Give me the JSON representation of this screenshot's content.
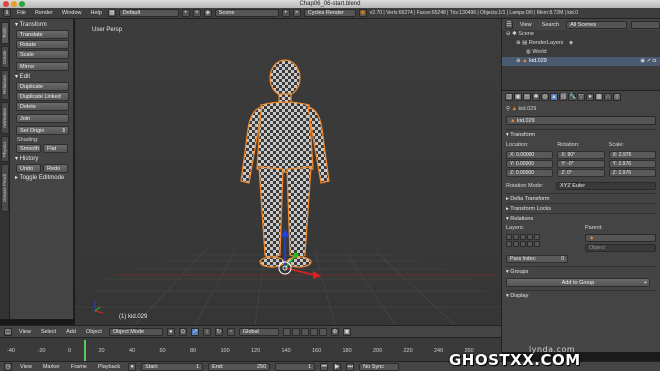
{
  "window_title": "Chap06_06-start.blend",
  "info": {
    "menus": [
      "File",
      "Render",
      "Window",
      "Help"
    ],
    "layout": "Default",
    "scene": "Scene",
    "engine": "Cycles Render",
    "stats": "v2.70 | Verts:66274 | Faces:65248 | Tris:130496 | Objects:1/1 | Lamps:0/0 | Mem:8.72M | kid.0"
  },
  "vertical_tabs": [
    "Tools",
    "Create",
    "Relations",
    "Animation",
    "Physics",
    "Grease Pencil"
  ],
  "tools": {
    "transform_header": "Transform",
    "transform_buttons": [
      "Translate",
      "Rotate",
      "Scale"
    ],
    "mirror": "Mirror",
    "edit_header": "Edit",
    "edit_buttons": [
      "Duplicate",
      "Duplicate Linked",
      "Delete"
    ],
    "join": "Join",
    "set_origin": "Set Origin",
    "shading_label": "Shading:",
    "smooth": "Smooth",
    "flat": "Flat",
    "history_header": "History",
    "undo": "Undo",
    "redo": "Redo",
    "toggle_editmode": "Toggle Editmode"
  },
  "viewport": {
    "label": "User Persp",
    "object_label": "(1) kid.029"
  },
  "viewport_header": {
    "menus": [
      "View",
      "Select",
      "Add",
      "Object"
    ],
    "mode": "Object Mode",
    "pivot": "Global"
  },
  "timeline": {
    "ticks": [
      "-40",
      "-20",
      "0",
      "20",
      "40",
      "60",
      "80",
      "100",
      "120",
      "140",
      "160",
      "180",
      "200",
      "220",
      "240",
      "260"
    ],
    "menus": [
      "View",
      "Marker",
      "Frame",
      "Playback"
    ],
    "start_label": "Start:",
    "start_value": "1",
    "end_label": "End:",
    "end_value": "250",
    "current": "1",
    "sync": "No Sync"
  },
  "outliner": {
    "header_menus": [
      "View",
      "Search"
    ],
    "filter": "All Scenes",
    "rows": [
      "Scene",
      "RenderLayers",
      "World",
      "kid.029"
    ]
  },
  "properties": {
    "breadcrumb": "kid.029",
    "object_name": "kid.029",
    "transform_header": "Transform",
    "location_label": "Location:",
    "rotation_label": "Rotation:",
    "scale_label": "Scale:",
    "location": [
      "X: 0.00000",
      "Y: 0.00000",
      "Z: 0.00000"
    ],
    "rotation": [
      "X: 90°",
      "Y: -0°",
      "Z: 0°"
    ],
    "scale": [
      "X: 2.976",
      "Y: 2.976",
      "Z: 2.976"
    ],
    "rotation_mode_label": "Rotation Mode:",
    "rotation_mode": "XYZ Euler",
    "delta_transform": "Delta Transform",
    "transform_locks": "Transform Locks",
    "relations": "Relations",
    "layers_label": "Layers:",
    "parent_label": "Parent:",
    "parent_type": "Object",
    "pass_index_label": "Pass Index:",
    "pass_index": "0",
    "groups": "Groups",
    "add_to_group": "Add to Group",
    "display": "Display"
  },
  "watermark": {
    "main": "GHOSTXX.COM",
    "sub": "lynda.com"
  },
  "colors": {
    "accent": "#5680c2",
    "selection_outline": "#f28a2a",
    "axis_x": "#e02020",
    "axis_y": "#20c020",
    "axis_z": "#2040e0"
  }
}
